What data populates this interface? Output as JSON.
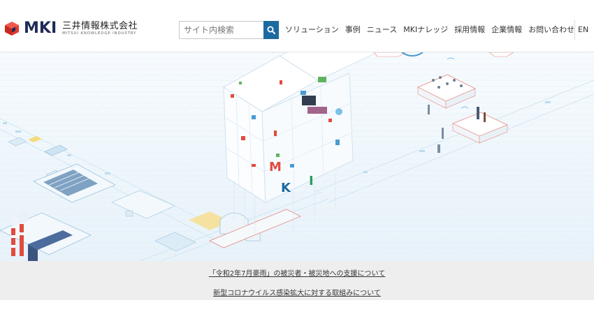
{
  "header": {
    "logo_mark": "MKI",
    "logo_jp": "三井情報株式会社",
    "logo_en": "MITSUI KNOWLEDGE INDUSTRY"
  },
  "search": {
    "placeholder": "サイト内検索",
    "icon": "search-icon"
  },
  "nav": {
    "items": [
      {
        "label": "ソリューション"
      },
      {
        "label": "事例"
      },
      {
        "label": "ニュース"
      },
      {
        "label": "MKIナレッジ"
      },
      {
        "label": "採用情報"
      },
      {
        "label": "企業情報"
      },
      {
        "label": "お問い合わせ"
      }
    ],
    "lang": "EN"
  },
  "hero": {
    "cube_letters": [
      "M",
      "K",
      "I"
    ]
  },
  "notices": [
    {
      "text": "「令和2年7月豪雨」の被災者・被災地への支援について"
    },
    {
      "text": "新型コロナウイルス感染拡大に対する取組みについて"
    }
  ],
  "colors": {
    "brand_navy": "#1f2a56",
    "brand_red": "#e33a2f",
    "search_blue": "#1d6aa0",
    "notice_bg": "#eeeeee"
  }
}
